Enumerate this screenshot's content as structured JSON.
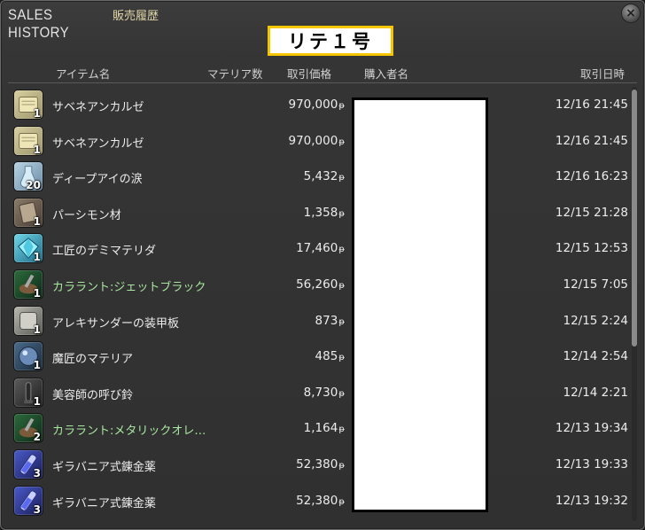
{
  "window": {
    "title_en": "SALES HISTORY",
    "title_jp": "販売履歴",
    "close_label": "×"
  },
  "retainer_tag": "リテ１号",
  "columns": {
    "item": "アイテム名",
    "materia": "マテリア数",
    "price": "取引価格",
    "buyer": "購入者名",
    "date": "取引日時"
  },
  "gil_symbol": "ᵽ",
  "rows": [
    {
      "icon": "parchment-icon",
      "qty": "1",
      "name": "サベネアンカルゼ",
      "price": "970,000",
      "date": "12/16 21:45",
      "green": false
    },
    {
      "icon": "parchment-icon",
      "qty": "1",
      "name": "サベネアンカルゼ",
      "price": "970,000",
      "date": "12/16 21:45",
      "green": false
    },
    {
      "icon": "vial-icon",
      "qty": "20",
      "name": "ディープアイの涙",
      "price": "5,432",
      "date": "12/16 16:23",
      "green": false
    },
    {
      "icon": "lumber-icon",
      "qty": "1",
      "name": "パーシモン材",
      "price": "1,358",
      "date": "12/15 21:28",
      "green": false
    },
    {
      "icon": "crystal-icon",
      "qty": "1",
      "name": "工匠のデミマテリダ",
      "price": "17,460",
      "date": "12/15 12:53",
      "green": false
    },
    {
      "icon": "dye-icon",
      "qty": "1",
      "name": "カララント:ジェットブラック",
      "price": "56,260",
      "date": "12/15 7:05",
      "green": true
    },
    {
      "icon": "plate-icon",
      "qty": "1",
      "name": "アレキサンダーの装甲板",
      "price": "873",
      "date": "12/15 2:24",
      "green": false
    },
    {
      "icon": "materia-icon",
      "qty": "1",
      "name": "魔匠のマテリア",
      "price": "485",
      "date": "12/14 2:54",
      "green": false
    },
    {
      "icon": "bell-icon",
      "qty": "1",
      "name": "美容師の呼び鈴",
      "price": "8,730",
      "date": "12/14 2:21",
      "green": false
    },
    {
      "icon": "dye-icon",
      "qty": "2",
      "name": "カララント:メタリックオレ…",
      "price": "1,164",
      "date": "12/13 19:34",
      "green": true
    },
    {
      "icon": "potion-icon",
      "qty": "3",
      "name": "ギラバニア式錬金薬",
      "price": "52,380",
      "date": "12/13 19:33",
      "green": false
    },
    {
      "icon": "potion-icon",
      "qty": "3",
      "name": "ギラバニア式錬金薬",
      "price": "52,380",
      "date": "12/13 19:32",
      "green": false
    }
  ],
  "colors": {
    "accent_yellow": "#f5c500",
    "hq_green": "#a8e8a0",
    "title_gold": "#e2d6a8"
  }
}
